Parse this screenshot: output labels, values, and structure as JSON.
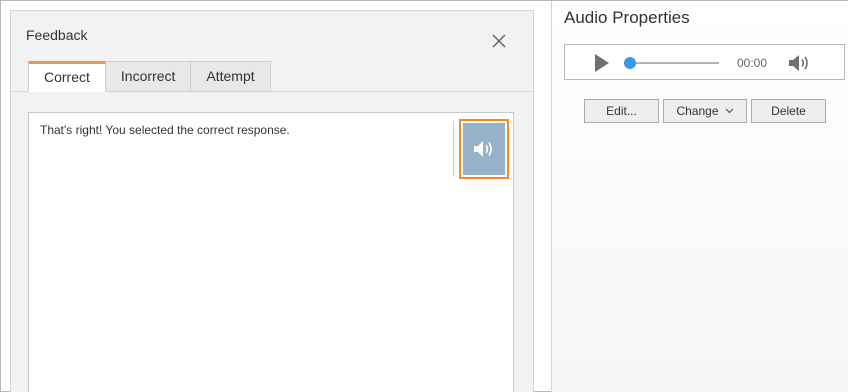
{
  "dialog": {
    "title": "Feedback",
    "tabs": [
      {
        "label": "Correct",
        "active": true
      },
      {
        "label": "Incorrect",
        "active": false
      },
      {
        "label": "Attempt",
        "active": false
      }
    ],
    "content_text": "That's right! You selected the correct response."
  },
  "audio_panel": {
    "title": "Audio Properties",
    "player": {
      "time": "00:00",
      "progress": 0
    },
    "buttons": {
      "edit_label": "Edit...",
      "change_label": "Change",
      "delete_label": "Delete"
    }
  },
  "colors": {
    "accent_tab": "#f0935a",
    "audio_button_border": "#ef8b2c",
    "audio_button_fill": "#97b3c9",
    "slider_thumb": "#3b98e6"
  },
  "icons": {
    "close": "close-icon",
    "speaker_button": "speaker-icon",
    "play": "play-icon",
    "volume": "volume-icon",
    "dropdown": "chevron-down-icon"
  }
}
